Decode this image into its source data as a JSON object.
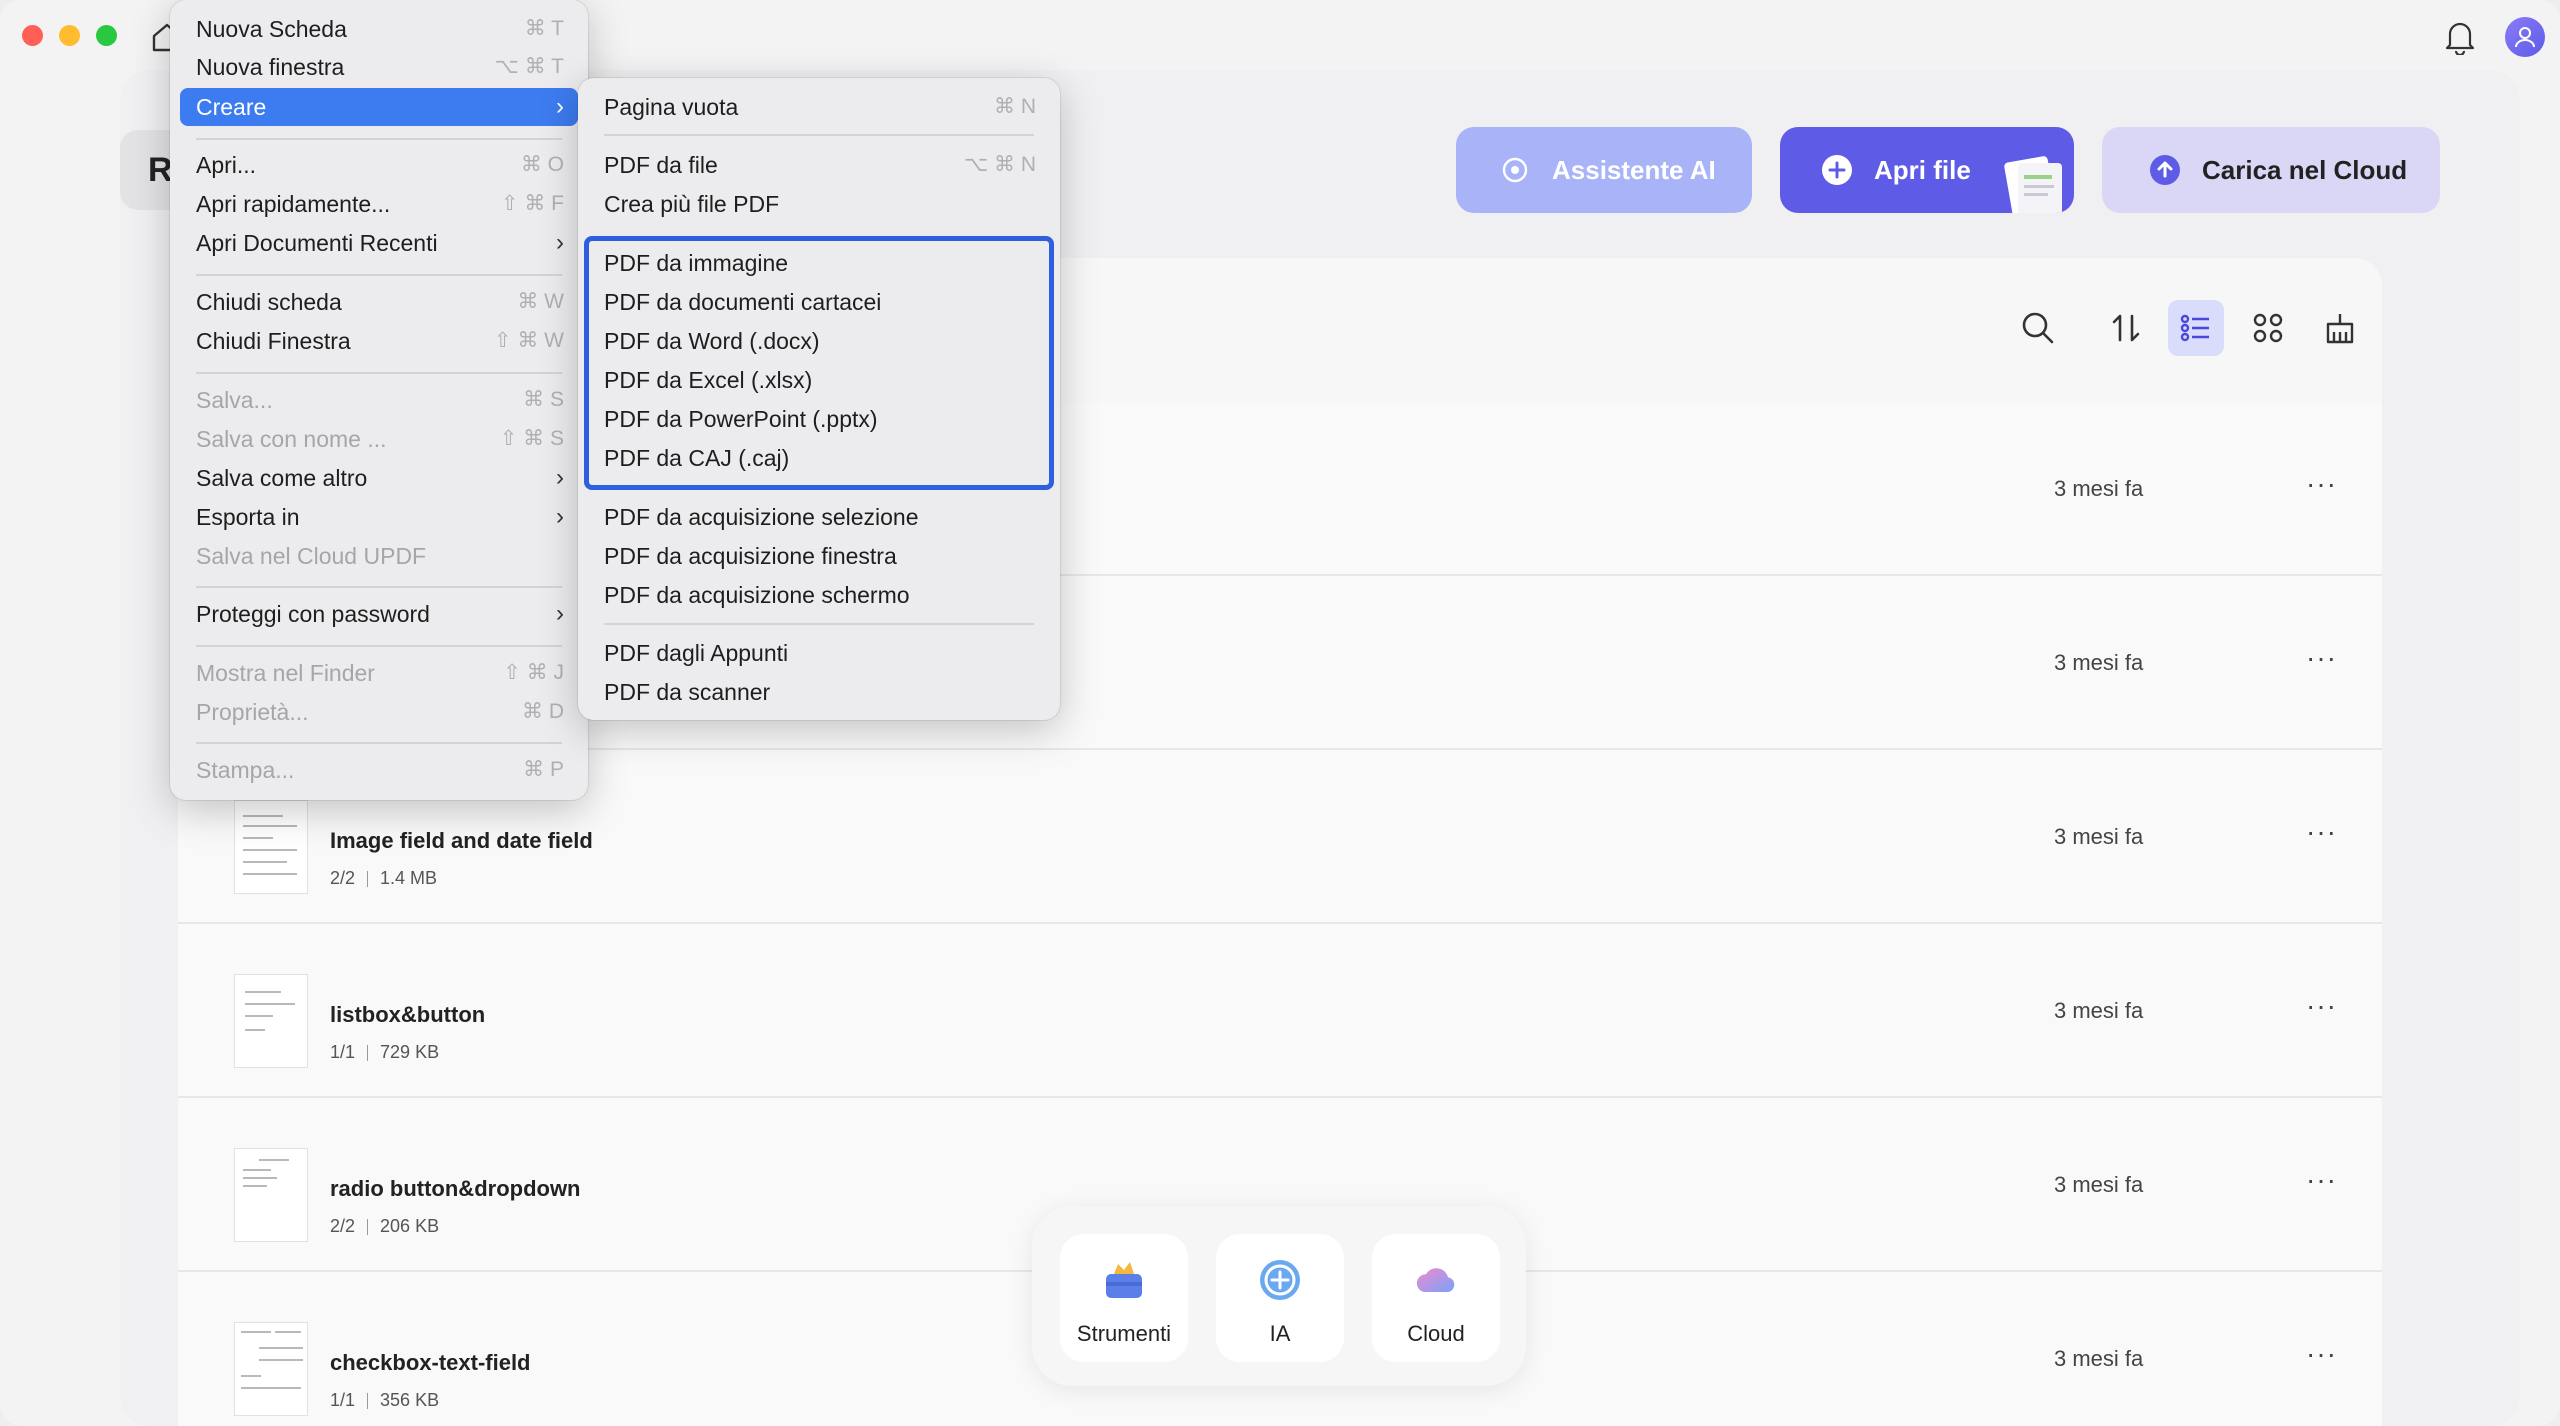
{
  "window": {
    "recent_tab_letter": "R"
  },
  "header_buttons": {
    "ai": "Assistente AI",
    "open": "Apri file",
    "cloud": "Carica nel Cloud"
  },
  "files": [
    {
      "name": "",
      "meta_pages": "",
      "meta_size": "",
      "date": "3 mesi fa"
    },
    {
      "name": "",
      "meta_pages": "",
      "meta_size": "",
      "date": "3 mesi fa"
    },
    {
      "name": "Image field and date field",
      "meta_pages": "2/2",
      "meta_size": "1.4 MB",
      "date": "3 mesi fa"
    },
    {
      "name": "listbox&button",
      "meta_pages": "1/1",
      "meta_size": "729 KB",
      "date": "3 mesi fa"
    },
    {
      "name": "radio button&dropdown",
      "meta_pages": "2/2",
      "meta_size": "206 KB",
      "date": "3 mesi fa"
    },
    {
      "name": "checkbox-text-field",
      "meta_pages": "1/1",
      "meta_size": "356 KB",
      "date": "3 mesi fa"
    }
  ],
  "more_glyph": "···",
  "dock": {
    "tools": "Strumenti",
    "ai": "IA",
    "cloud": "Cloud"
  },
  "main_menu": {
    "new_tab": {
      "label": "Nuova Scheda",
      "shortcut": "⌘ T"
    },
    "new_window": {
      "label": "Nuova finestra",
      "shortcut": "⌥ ⌘ T"
    },
    "create": {
      "label": "Creare"
    },
    "open": {
      "label": "Apri...",
      "shortcut": "⌘ O"
    },
    "quick_open": {
      "label": "Apri rapidamente...",
      "shortcut": "⇧ ⌘ F"
    },
    "recent": {
      "label": "Apri Documenti Recenti"
    },
    "close_tab": {
      "label": "Chiudi scheda",
      "shortcut": "⌘ W"
    },
    "close_window": {
      "label": "Chiudi Finestra",
      "shortcut": "⇧ ⌘ W"
    },
    "save": {
      "label": "Salva...",
      "shortcut": "⌘ S"
    },
    "save_as": {
      "label": "Salva con nome ...",
      "shortcut": "⇧ ⌘ S"
    },
    "save_other": {
      "label": "Salva come altro"
    },
    "export": {
      "label": "Esporta in"
    },
    "save_cloud": {
      "label": "Salva nel Cloud UPDF"
    },
    "protect": {
      "label": "Proteggi con password"
    },
    "show_finder": {
      "label": "Mostra nel Finder",
      "shortcut": "⇧ ⌘ J"
    },
    "properties": {
      "label": "Proprietà...",
      "shortcut": "⌘ D"
    },
    "print": {
      "label": "Stampa...",
      "shortcut": "⌘ P"
    }
  },
  "sub_menu": {
    "blank": {
      "label": "Pagina vuota",
      "shortcut": "⌘ N"
    },
    "from_file": {
      "label": "PDF da file",
      "shortcut": "⌥ ⌘ N"
    },
    "multi": {
      "label": "Crea più file PDF"
    },
    "image": {
      "label": "PDF da immagine"
    },
    "paper": {
      "label": "PDF da documenti cartacei"
    },
    "word": {
      "label": "PDF da Word (.docx)"
    },
    "excel": {
      "label": "PDF da Excel (.xlsx)"
    },
    "ppt": {
      "label": "PDF da PowerPoint (.pptx)"
    },
    "caj": {
      "label": "PDF da CAJ (.caj)"
    },
    "cap_sel": {
      "label": "PDF da acquisizione selezione"
    },
    "cap_win": {
      "label": "PDF da acquisizione finestra"
    },
    "cap_screen": {
      "label": "PDF da acquisizione schermo"
    },
    "clipboard": {
      "label": "PDF dagli Appunti"
    },
    "scanner": {
      "label": "PDF da scanner"
    }
  },
  "colors": {
    "accent": "#5e5ce6",
    "menu_selected": "#3d7bf0",
    "highlight_border": "#2f5fde"
  }
}
